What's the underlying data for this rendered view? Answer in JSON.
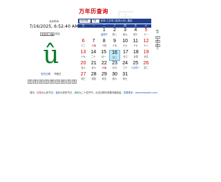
{
  "page": {
    "title": "万年历查询",
    "watermark": "历"
  },
  "clock": {
    "caption": "北京时间",
    "time": "7/16/2025, 6:52:40 AM"
  },
  "city": {
    "selected": "北京[东八区]",
    "label": "时区"
  },
  "glyph": {
    "char": "û",
    "caption_left": "农历日期",
    "caption_right": "节假日"
  },
  "keypad": [
    "天",
    "年",
    "月",
    "日",
    "时",
    "分",
    "秒",
    "今",
    "天"
  ],
  "header": {
    "year": "2025年",
    "month": "7月",
    "info": "蛇年 乙巳年 [农历六月]",
    "tag": "属蛇"
  },
  "weekdays": [
    "日",
    "一",
    "二",
    "三",
    "四",
    "五",
    "六"
  ],
  "weeks": [
    [
      {
        "n": "",
        "s": "",
        "empty": true
      },
      {
        "n": "",
        "s": "",
        "empty": true
      },
      {
        "n": "1",
        "s": "建党节",
        "hol": true
      },
      {
        "n": "2",
        "s": "初八"
      },
      {
        "n": "3",
        "s": "初九"
      },
      {
        "n": "4",
        "s": "初十"
      },
      {
        "n": "5",
        "s": "十一",
        "red": true
      }
    ],
    [
      {
        "n": "6",
        "s": "十二",
        "red": true
      },
      {
        "n": "7",
        "s": "小暑",
        "term": true
      },
      {
        "n": "8",
        "s": "十四"
      },
      {
        "n": "9",
        "s": "十五"
      },
      {
        "n": "10",
        "s": "十六"
      },
      {
        "n": "11",
        "s": "十七"
      },
      {
        "n": "12",
        "s": "十八",
        "red": true
      }
    ],
    [
      {
        "n": "13",
        "s": "十九",
        "red": true
      },
      {
        "n": "14",
        "s": "二十"
      },
      {
        "n": "15",
        "s": "廿一"
      },
      {
        "n": "16",
        "s": "廿二",
        "today": true
      },
      {
        "n": "17",
        "s": "廿三"
      },
      {
        "n": "18",
        "s": "廿四"
      },
      {
        "n": "19",
        "s": "廿五",
        "red": true
      }
    ],
    [
      {
        "n": "20",
        "s": "廿六",
        "red": true
      },
      {
        "n": "21",
        "s": "廿七"
      },
      {
        "n": "22",
        "s": "大暑",
        "term": true
      },
      {
        "n": "23",
        "s": "廿九"
      },
      {
        "n": "24",
        "s": "三十"
      },
      {
        "n": "25",
        "s": "六月初一",
        "hol": true
      },
      {
        "n": "26",
        "s": "初二",
        "red": true
      }
    ],
    [
      {
        "n": "27",
        "s": "初三",
        "red": true
      },
      {
        "n": "28",
        "s": "初四"
      },
      {
        "n": "29",
        "s": "初五"
      },
      {
        "n": "30",
        "s": "初六"
      },
      {
        "n": "31",
        "s": "初七"
      },
      {
        "n": "",
        "s": "",
        "empty": true
      },
      {
        "n": "",
        "s": "",
        "empty": true
      }
    ]
  ],
  "side": {
    "num": "5",
    "btn_prev": "上月",
    "btn_next": "下月",
    "btn_today": "今天"
  },
  "footer": {
    "p1": "提示：",
    "p2": "红色",
    "p3": "为公历节日，",
    "p4": "蓝色",
    "p5": "为农历节日，",
    "p6": "绿色",
    "p7": "为二十四节气。点击日期可查看详细信息。",
    "p8": "查看更多：www.example.com"
  },
  "colors": {
    "accent": "#1f3f8f",
    "red": "#cc0000",
    "green": "#0a7a2a",
    "blue": "#1a4fb3",
    "today": "#bfe8f5"
  }
}
